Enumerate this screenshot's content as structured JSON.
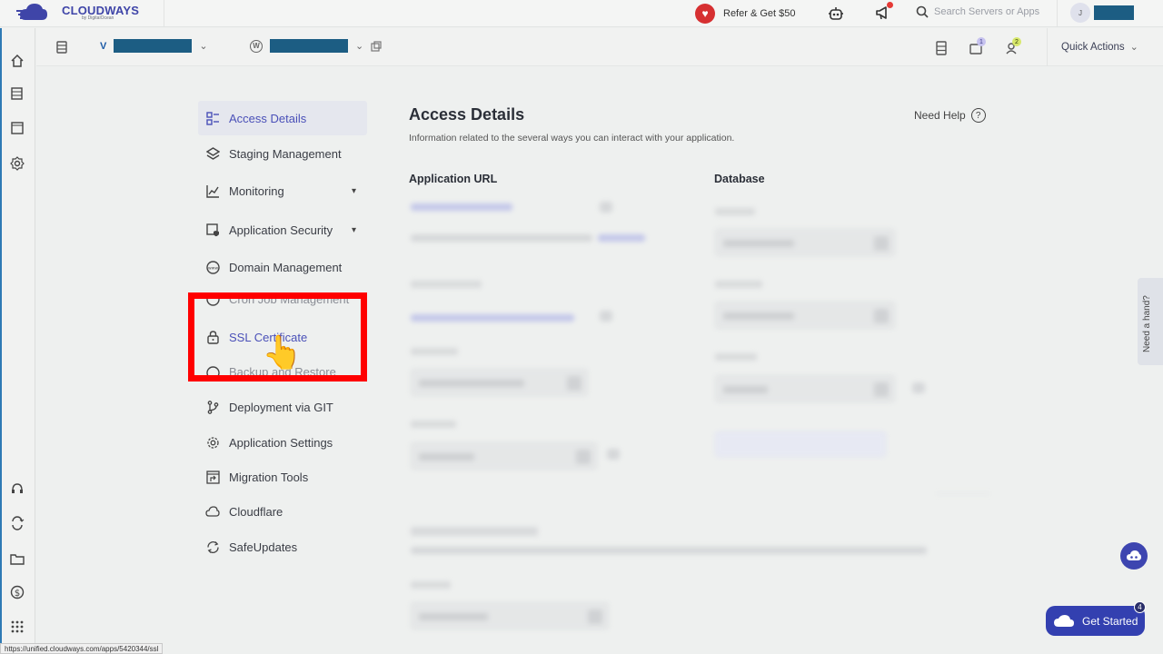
{
  "topbar": {
    "brand": "CLOUDWAYS",
    "brand_sub": "by DigitalOcean",
    "refer_label": "Refer & Get $50",
    "search_placeholder": "Search Servers or Apps",
    "user_initial": "J"
  },
  "subbar": {
    "quick_actions": "Quick Actions",
    "badge_one": "1",
    "badge_two": "2"
  },
  "menu": {
    "items": [
      {
        "label": "Access Details"
      },
      {
        "label": "Staging Management"
      },
      {
        "label": "Monitoring"
      },
      {
        "label": "Application Security"
      },
      {
        "label": "Domain Management"
      },
      {
        "label": "Cron Job Management"
      },
      {
        "label": "SSL Certificate"
      },
      {
        "label": "Backup and Restore"
      },
      {
        "label": "Deployment via GIT"
      },
      {
        "label": "Application Settings"
      },
      {
        "label": "Migration Tools"
      },
      {
        "label": "Cloudflare"
      },
      {
        "label": "SafeUpdates"
      }
    ]
  },
  "main": {
    "title": "Access Details",
    "subtitle": "Information related to the several ways you can interact with your application.",
    "need_help": "Need Help",
    "app_url_heading": "Application URL",
    "database_heading": "Database"
  },
  "floating": {
    "need_a_hand": "Need a hand?",
    "get_started": "Get Started",
    "get_started_badge": "4"
  },
  "status_url": "https://unified.cloudways.com/apps/5420344/ssl",
  "colors": {
    "brand": "#3f45a8",
    "redact": "#1c5d83",
    "highlight": "#ff0000",
    "get_started_bg": "#3340b0"
  }
}
